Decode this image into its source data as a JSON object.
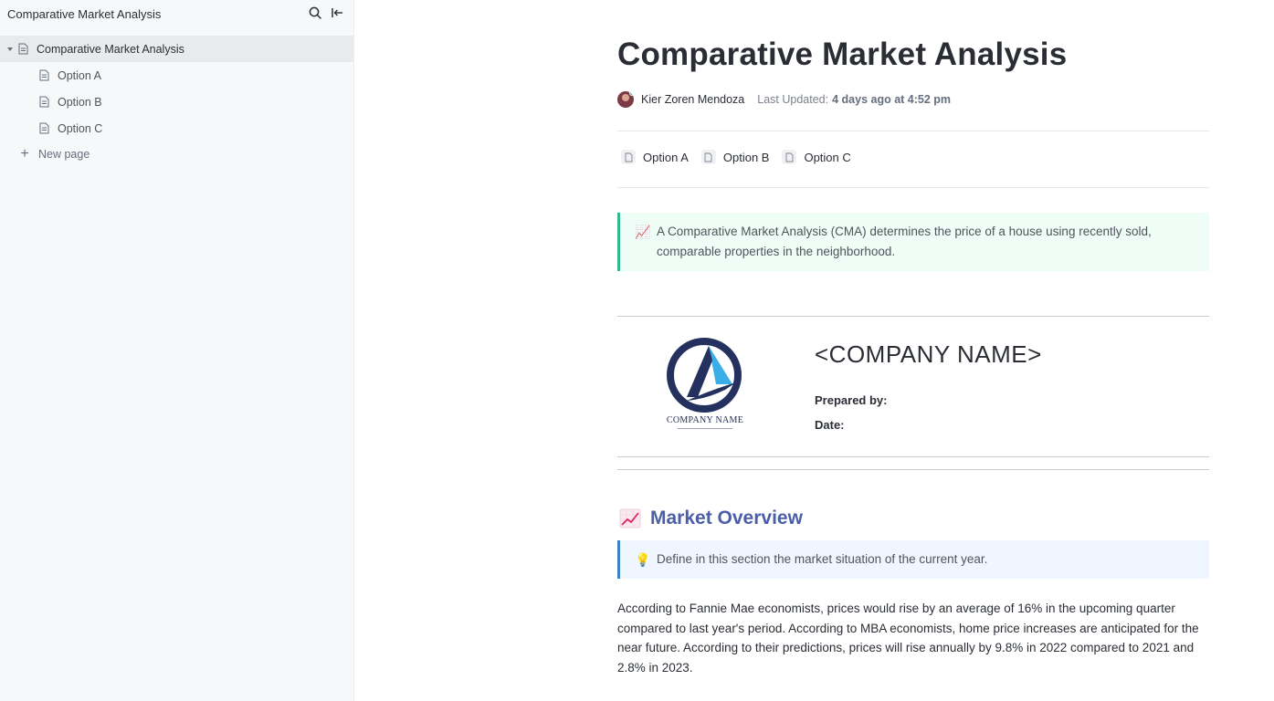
{
  "sidebar": {
    "title": "Comparative Market Analysis",
    "tools": {
      "search_icon": "search-icon",
      "collapse_icon": "collapse-left-icon"
    },
    "tree": {
      "root": "Comparative Market Analysis",
      "children": [
        "Option A",
        "Option B",
        "Option C"
      ],
      "new_page": "New page"
    }
  },
  "document": {
    "title": "Comparative Market Analysis",
    "author": "Kier Zoren Mendoza",
    "last_updated_label": "Last Updated:",
    "last_updated_value": "4 days ago at 4:52 pm",
    "subpages": [
      "Option A",
      "Option B",
      "Option C"
    ],
    "intro_callout": {
      "emoji": "📈",
      "text": "A Comparative Market Analysis (CMA) determines the price of a house using recently sold, comparable properties in the neighborhood."
    },
    "company": {
      "logo_text": "COMPANY NAME",
      "name": "<COMPANY NAME>",
      "prepared_by": "Prepared by:",
      "date": "Date:"
    },
    "market_overview": {
      "emoji": "📈",
      "heading": "Market Overview",
      "tip_emoji": "💡",
      "tip": "Define in this section the market situation of the current year.",
      "paragraph": "According to Fannie Mae economists, prices would rise by an average of 16% in the upcoming quarter compared to last year's period. According to MBA economists, home price increases are anticipated for the near future. According to their predictions, prices will rise annually by 9.8% in 2022 compared to 2021 and 2.8% in 2023."
    }
  },
  "colors": {
    "callout_green_border": "#32b98a",
    "callout_green_bg": "#effdf7",
    "callout_blue_border": "#3b82c4",
    "callout_blue_bg": "#f0f6ff",
    "section_heading": "#4b5ea8",
    "logo_navy": "#24315e",
    "logo_cyan": "#3aaee8"
  }
}
